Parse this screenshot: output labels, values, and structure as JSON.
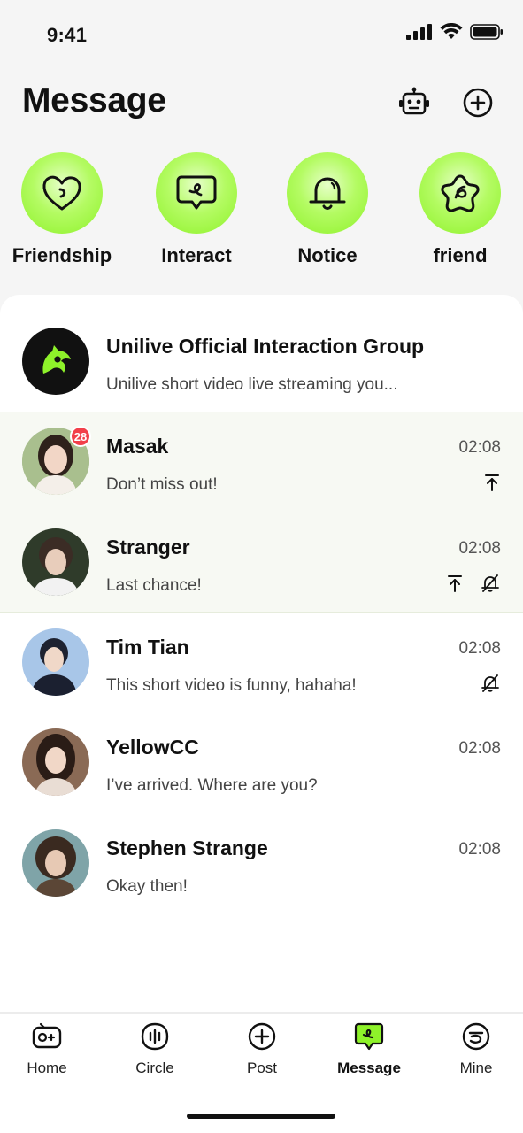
{
  "status_bar": {
    "time": "9:41",
    "icons": [
      "signal-icon",
      "wifi-icon",
      "battery-icon"
    ]
  },
  "header": {
    "title": "Message",
    "actions": [
      "robot-icon",
      "add-circle-icon"
    ]
  },
  "shortcuts": [
    {
      "label": "Friendship",
      "icon": "heart-icon"
    },
    {
      "label": "Interact",
      "icon": "chat-bubble-icon"
    },
    {
      "label": "Notice",
      "icon": "bell-icon"
    },
    {
      "label": "friend",
      "icon": "flower-icon"
    }
  ],
  "conversations": [
    {
      "name": "Unilive Official Interaction Group",
      "preview": "Unilive short video live streaming you...",
      "time": "",
      "badge": "",
      "pinned": false,
      "muted": false,
      "avatar": "unilive-logo"
    },
    {
      "name": "Masak",
      "preview": "Don’t miss out!",
      "time": "02:08",
      "badge": "28",
      "pinned": true,
      "muted": false,
      "avatar": "photo"
    },
    {
      "name": "Stranger",
      "preview": "Last chance!",
      "time": "02:08",
      "badge": "",
      "pinned": true,
      "muted": true,
      "avatar": "photo"
    },
    {
      "name": "Tim Tian",
      "preview": "This short video is funny, hahaha!",
      "time": "02:08",
      "badge": "",
      "pinned": false,
      "muted": true,
      "avatar": "photo"
    },
    {
      "name": "YellowCC",
      "preview": "I’ve arrived. Where are you?",
      "time": "02:08",
      "badge": "",
      "pinned": false,
      "muted": false,
      "avatar": "photo"
    },
    {
      "name": "Stephen Strange",
      "preview": "Okay then!",
      "time": "02:08",
      "badge": "",
      "pinned": false,
      "muted": false,
      "avatar": "photo"
    }
  ],
  "bottom_nav": {
    "items": [
      {
        "label": "Home",
        "icon": "gamepad-icon",
        "active": false
      },
      {
        "label": "Circle",
        "icon": "circle-bars-icon",
        "active": false
      },
      {
        "label": "Post",
        "icon": "plus-circle-icon",
        "active": false
      },
      {
        "label": "Message",
        "icon": "message-bubble-icon",
        "active": true
      },
      {
        "label": "Mine",
        "icon": "profile-icon",
        "active": false
      }
    ]
  },
  "colors": {
    "accent_green": "#9ef53a",
    "badge_red": "#f2404a",
    "pinned_bg": "#f7f9f3"
  }
}
